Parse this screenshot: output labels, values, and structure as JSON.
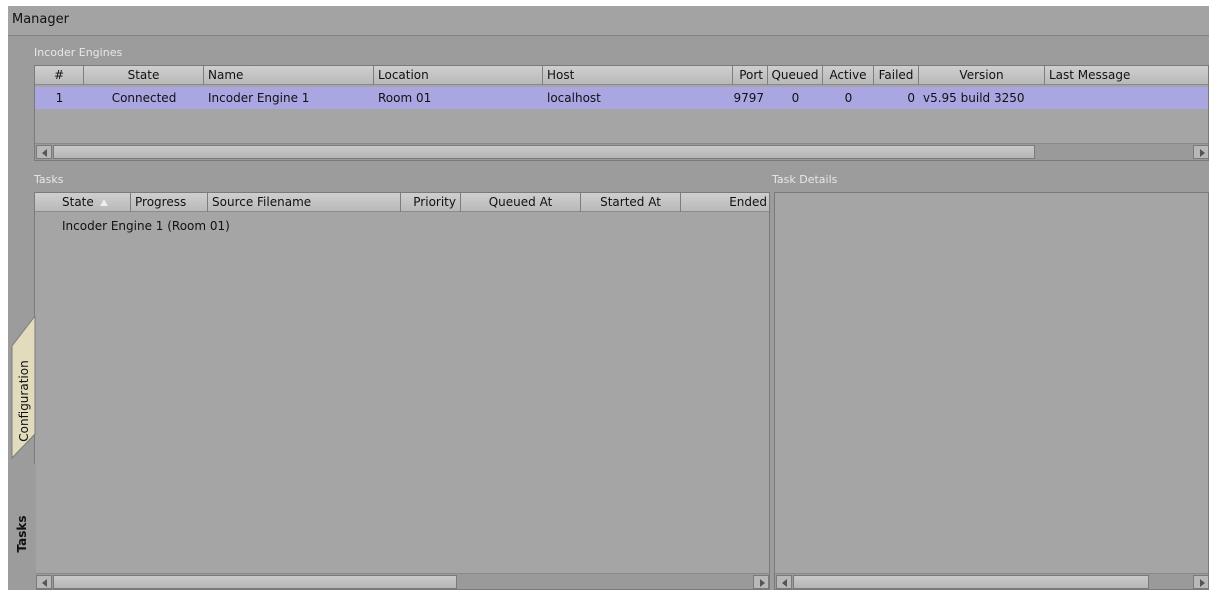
{
  "window": {
    "title": "Manager"
  },
  "engines": {
    "label": "Incoder Engines",
    "columns": {
      "num": "#",
      "state": "State",
      "name": "Name",
      "location": "Location",
      "host": "Host",
      "port": "Port",
      "queued": "Queued",
      "active": "Active",
      "failed": "Failed",
      "version": "Version",
      "last_message": "Last Message"
    },
    "rows": [
      {
        "num": "1",
        "state": "Connected",
        "name": "Incoder Engine 1",
        "location": "Room 01",
        "host": "localhost",
        "port": "9797",
        "queued": "0",
        "active": "0",
        "failed": "0",
        "version": "v5.95 build 3250",
        "last_message": ""
      }
    ]
  },
  "tasks": {
    "label": "Tasks",
    "columns": {
      "state": "State",
      "progress": "Progress",
      "source": "Source Filename",
      "priority": "Priority",
      "queued_at": "Queued At",
      "started_at": "Started At",
      "ended": "Ended"
    },
    "sort_icon": "sort-ascending-triangle",
    "groups": [
      {
        "label": "Incoder Engine 1 (Room 01)"
      }
    ]
  },
  "details": {
    "label": "Task Details"
  },
  "side_tabs": {
    "configuration": "Configuration",
    "tasks": "Tasks"
  }
}
